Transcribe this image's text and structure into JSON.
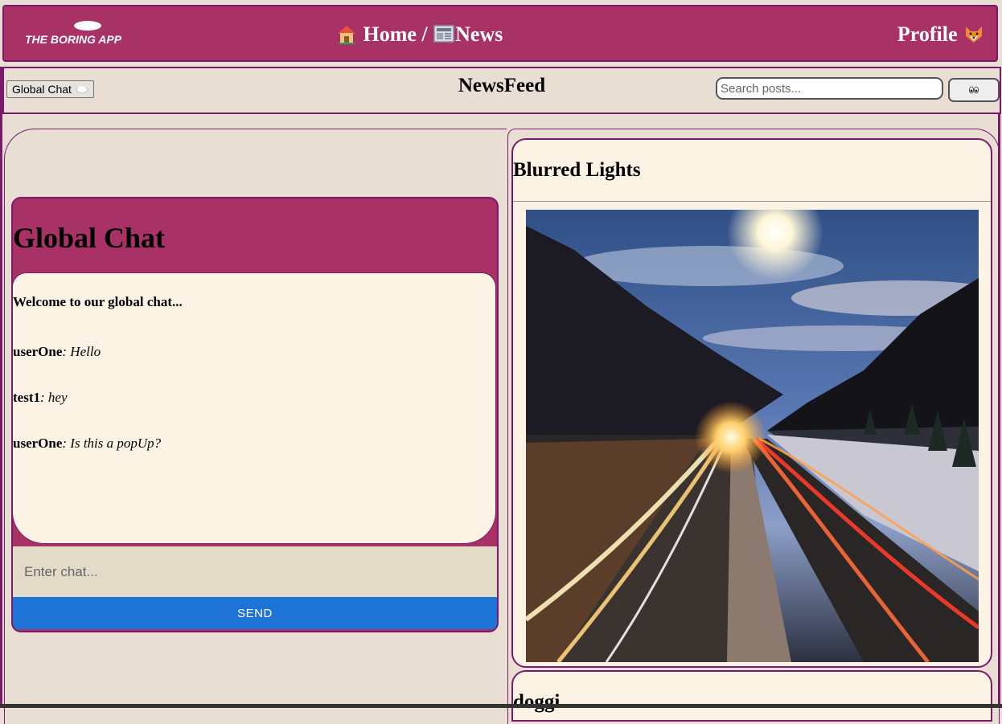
{
  "header": {
    "logo_text": "THE BORING APP",
    "breadcrumb": [
      {
        "icon": "house-icon",
        "label": "Home"
      },
      {
        "separator": "/"
      },
      {
        "icon": "newspaper-icon",
        "label": "News"
      }
    ],
    "profile": {
      "label": "Profile",
      "icon": "fox-icon"
    }
  },
  "subheader": {
    "chat_toggle_label": "Global Chat",
    "chat_toggle_icon": "cloud-icon",
    "title": "NewsFeed",
    "search_placeholder": "Search posts...",
    "search_button_icon": "eyes-icon"
  },
  "chat": {
    "title": "Global Chat",
    "welcome": "Welcome to our global chat...",
    "messages": [
      {
        "user": "userOne",
        "text": ": Hello"
      },
      {
        "user": "test1",
        "text": ": hey"
      },
      {
        "user": "userOne",
        "text": ": Is this a popUp?"
      }
    ],
    "input_placeholder": "Enter chat...",
    "send_label": "SEND"
  },
  "posts": [
    {
      "title": "Blurred Lights",
      "image": "night highway with blurred car light trails between mountains"
    },
    {
      "title": "doggi"
    }
  ],
  "colors": {
    "brand": "#a83266",
    "border": "#7a1a6a",
    "background": "#e8ded3",
    "card": "#fcf3e4",
    "send_button": "#1e73d6"
  }
}
